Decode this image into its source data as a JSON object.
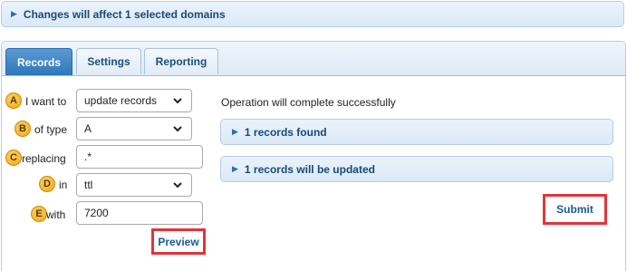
{
  "banner": {
    "text": "Changes will affect 1 selected domains",
    "icon": "caret-right-icon"
  },
  "tabs": [
    {
      "label": "Records",
      "active": true
    },
    {
      "label": "Settings",
      "active": false
    },
    {
      "label": "Reporting",
      "active": false
    }
  ],
  "form": {
    "rows": [
      {
        "badge": "A",
        "label": "I want to",
        "kind": "select",
        "value": "update records"
      },
      {
        "badge": "B",
        "label": "of type",
        "kind": "select",
        "value": "A"
      },
      {
        "badge": "C",
        "label": "replacing",
        "kind": "input",
        "value": ".*"
      },
      {
        "badge": "D",
        "label": "in",
        "kind": "select",
        "value": "ttl"
      },
      {
        "badge": "E",
        "label": "with",
        "kind": "input",
        "value": "7200"
      }
    ],
    "preview_label": "Preview"
  },
  "result": {
    "status": "Operation will complete successfully",
    "sections": [
      {
        "label": "1 records found"
      },
      {
        "label": "1 records will be updated"
      }
    ],
    "submit_label": "Submit"
  },
  "colors": {
    "highlight": "#e0343a",
    "badge": "#f2a60f",
    "active_tab": "#2f77bb"
  }
}
